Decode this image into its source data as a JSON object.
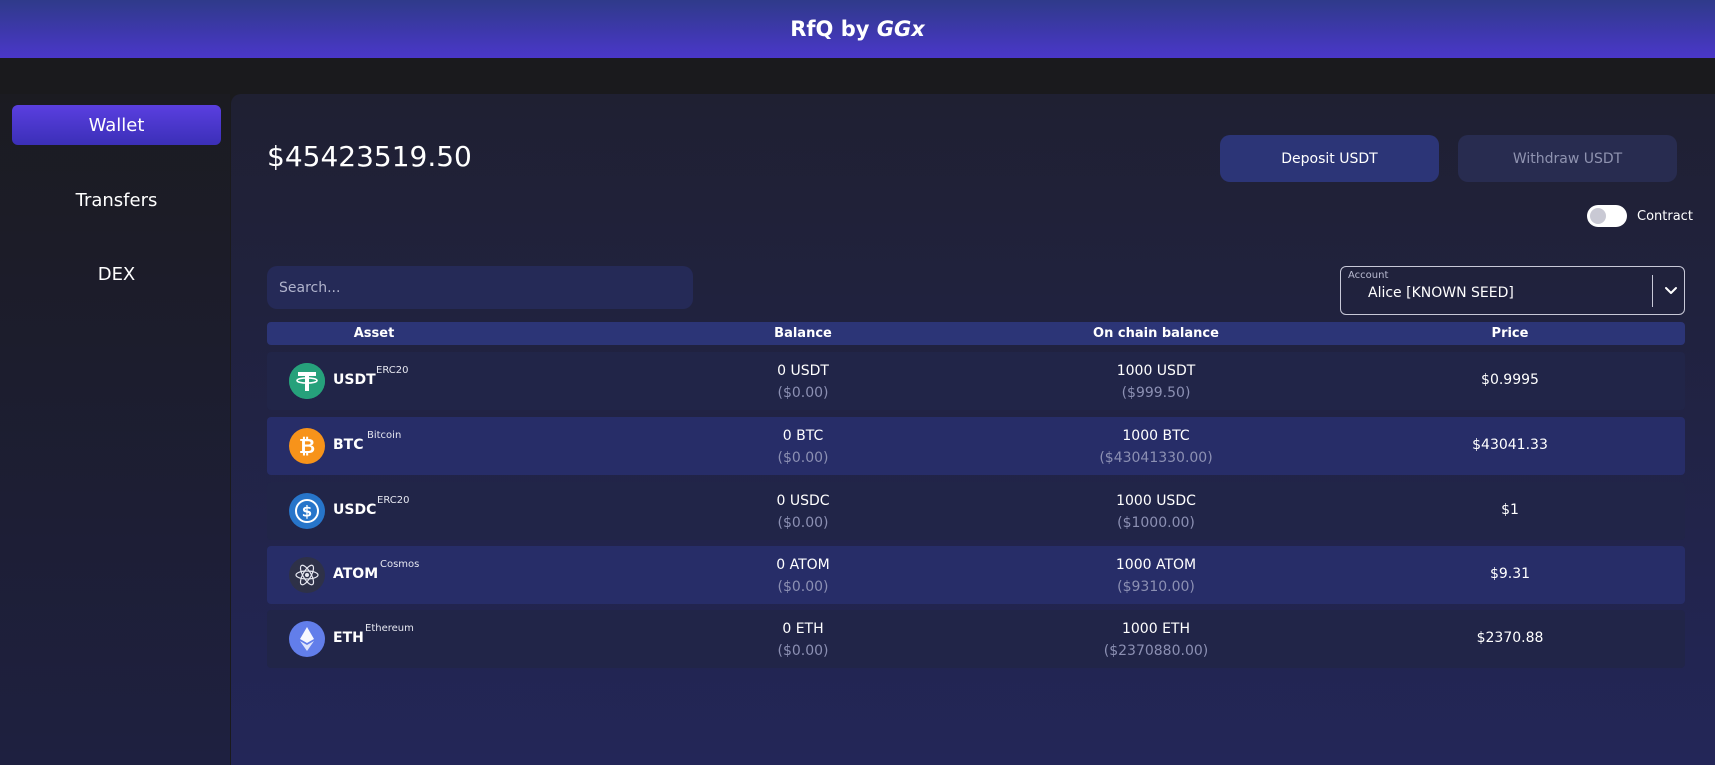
{
  "header": {
    "title_prefix": "RfQ by ",
    "title_brand": "GGx"
  },
  "sidebar": {
    "items": [
      {
        "label": "Wallet",
        "active": true
      },
      {
        "label": "Transfers",
        "active": false
      },
      {
        "label": "DEX",
        "active": false
      }
    ]
  },
  "wallet": {
    "total": "$45423519.50",
    "deposit_label": "Deposit USDT",
    "withdraw_label": "Withdraw USDT",
    "contract_label": "Contract",
    "contract_on": false,
    "search_placeholder": "Search...",
    "account_label": "Account",
    "account_value": "Alice [KNOWN SEED]"
  },
  "table": {
    "headers": {
      "asset": "Asset",
      "balance": "Balance",
      "onchain": "On chain balance",
      "price": "Price"
    },
    "rows": [
      {
        "symbol": "USDT",
        "chain": "ERC20",
        "icon": "usdt-icon",
        "color": "#26a17b",
        "balance": "0 USDT",
        "balance_usd": "($0.00)",
        "onchain": "1000 USDT",
        "onchain_usd": "($999.50)",
        "price": "$0.9995"
      },
      {
        "symbol": "BTC",
        "chain": "Bitcoin",
        "icon": "btc-icon",
        "color": "#f7931a",
        "balance": "0 BTC",
        "balance_usd": "($0.00)",
        "onchain": "1000 BTC",
        "onchain_usd": "($43041330.00)",
        "price": "$43041.33"
      },
      {
        "symbol": "USDC",
        "chain": "ERC20",
        "icon": "usdc-icon",
        "color": "#2775ca",
        "balance": "0 USDC",
        "balance_usd": "($0.00)",
        "onchain": "1000 USDC",
        "onchain_usd": "($1000.00)",
        "price": "$1"
      },
      {
        "symbol": "ATOM",
        "chain": "Cosmos",
        "icon": "atom-icon",
        "color": "#2e3148",
        "balance": "0 ATOM",
        "balance_usd": "($0.00)",
        "onchain": "1000 ATOM",
        "onchain_usd": "($9310.00)",
        "price": "$9.31"
      },
      {
        "symbol": "ETH",
        "chain": "Ethereum",
        "icon": "eth-icon",
        "color": "#627eea",
        "balance": "0 ETH",
        "balance_usd": "($0.00)",
        "onchain": "1000 ETH",
        "onchain_usd": "($2370880.00)",
        "price": "$2370.88"
      }
    ]
  }
}
